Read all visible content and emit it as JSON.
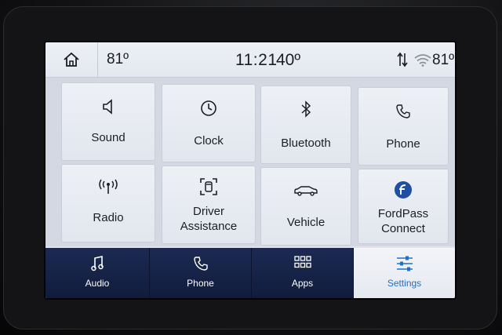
{
  "status_bar": {
    "home_icon": "home-icon",
    "outside_temp_left": "81º",
    "time": "11:21",
    "cabin_temp": "40º",
    "sync_icon": "data-sync-icon",
    "wifi_icon": "wifi-icon",
    "outside_temp_right": "81º"
  },
  "tiles": [
    {
      "label": "Sound",
      "icon": "speaker-icon"
    },
    {
      "label": "Clock",
      "icon": "clock-icon"
    },
    {
      "label": "Bluetooth",
      "icon": "bluetooth-icon"
    },
    {
      "label": "Phone",
      "icon": "phone-icon"
    },
    {
      "label": "Radio",
      "icon": "radio-antenna-icon"
    },
    {
      "label_line1": "Driver",
      "label_line2": "Assistance",
      "icon": "driver-assist-icon"
    },
    {
      "label": "Vehicle",
      "icon": "car-icon"
    },
    {
      "label_line1": "FordPass",
      "label_line2": "Connect",
      "icon": "fordpass-icon"
    }
  ],
  "pagination": {
    "active_color": "#2f7fe0",
    "inactive_color": "#8a90a0"
  },
  "bottom_nav": [
    {
      "label": "Audio",
      "icon": "music-note-icon"
    },
    {
      "label": "Phone",
      "icon": "phone-icon"
    },
    {
      "label": "Apps",
      "icon": "apps-grid-icon"
    },
    {
      "label": "Settings",
      "icon": "settings-sliders-icon",
      "active": true
    }
  ],
  "colors": {
    "accent": "#1f6fc8",
    "nav_bg": "#16224a"
  }
}
